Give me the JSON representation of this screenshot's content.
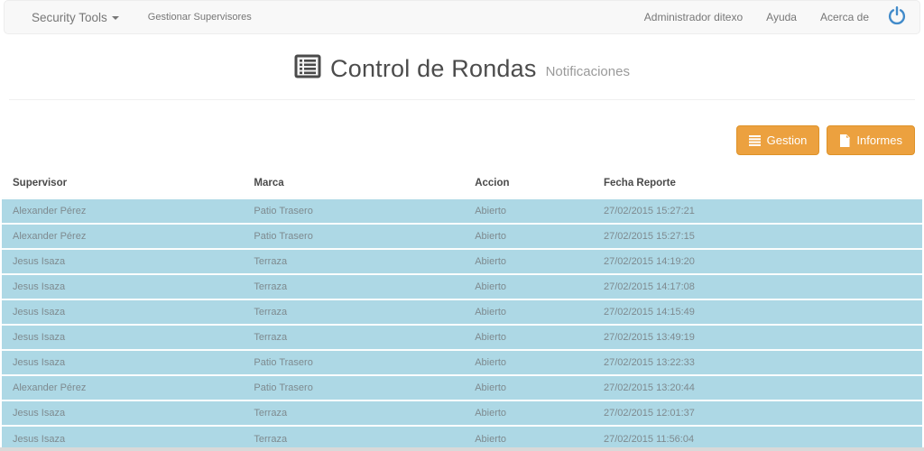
{
  "navbar": {
    "left": [
      {
        "label": "Security Tools"
      },
      {
        "label": "Gestionar Supervisores"
      }
    ],
    "right": [
      {
        "label": "Administrador ditexo"
      },
      {
        "label": "Ayuda"
      },
      {
        "label": "Acerca de"
      }
    ],
    "power_icon_color": "#428bca"
  },
  "header": {
    "title": "Control de Rondas",
    "subtitle": "Notificaciones"
  },
  "toolbar": {
    "gestion_label": "Gestion",
    "informes_label": "Informes",
    "button_color": "#eca13f"
  },
  "table": {
    "columns": [
      "Supervisor",
      "Marca",
      "Accion",
      "Fecha Reporte"
    ],
    "rows": [
      [
        "Alexander Pérez",
        "Patio Trasero",
        "Abierto",
        "27/02/2015 15:27:21"
      ],
      [
        "Alexander Pérez",
        "Patio Trasero",
        "Abierto",
        "27/02/2015 15:27:15"
      ],
      [
        "Jesus Isaza",
        "Terraza",
        "Abierto",
        "27/02/2015 14:19:20"
      ],
      [
        "Jesus Isaza",
        "Terraza",
        "Abierto",
        "27/02/2015 14:17:08"
      ],
      [
        "Jesus Isaza",
        "Terraza",
        "Abierto",
        "27/02/2015 14:15:49"
      ],
      [
        "Jesus Isaza",
        "Terraza",
        "Abierto",
        "27/02/2015 13:49:19"
      ],
      [
        "Jesus Isaza",
        "Patio Trasero",
        "Abierto",
        "27/02/2015 13:22:33"
      ],
      [
        "Alexander Pérez",
        "Patio Trasero",
        "Abierto",
        "27/02/2015 13:20:44"
      ],
      [
        "Jesus Isaza",
        "Terraza",
        "Abierto",
        "27/02/2015 12:01:37"
      ],
      [
        "Jesus Isaza",
        "Terraza",
        "Abierto",
        "27/02/2015 11:56:04"
      ]
    ],
    "row_color": "#add8e5"
  }
}
